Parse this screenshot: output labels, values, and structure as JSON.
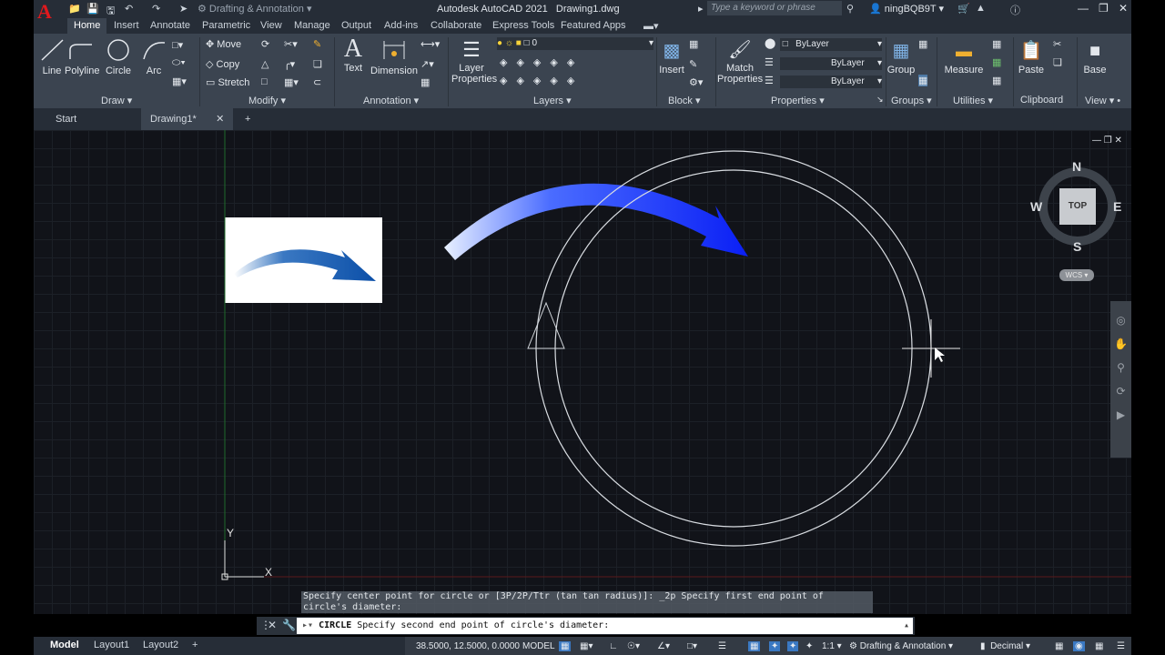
{
  "titlebar": {
    "workspace": "Drafting & Annotation",
    "app_title": "Autodesk AutoCAD 2021",
    "file_name": "Drawing1.dwg",
    "search_placeholder": "Type a keyword or phrase",
    "user": "ningBQB9T"
  },
  "ribbon_tabs": [
    "Home",
    "Insert",
    "Annotate",
    "Parametric",
    "View",
    "Manage",
    "Output",
    "Add-ins",
    "Collaborate",
    "Express Tools",
    "Featured Apps"
  ],
  "ribbon": {
    "draw": {
      "line": "Line",
      "polyline": "Polyline",
      "circle": "Circle",
      "arc": "Arc",
      "title": "Draw"
    },
    "modify": {
      "move": "Move",
      "copy": "Copy",
      "stretch": "Stretch",
      "title": "Modify"
    },
    "annotation": {
      "text": "Text",
      "dimension": "Dimension",
      "title": "Annotation"
    },
    "layers": {
      "layer_properties": "Layer Properties",
      "current_layer": "0",
      "title": "Layers"
    },
    "block": {
      "insert": "Insert",
      "title": "Block"
    },
    "properties": {
      "match": "Match Properties",
      "color": "ByLayer",
      "linetype": "ByLayer",
      "lineweight": "ByLayer",
      "title": "Properties"
    },
    "groups": {
      "group": "Group",
      "title": "Groups"
    },
    "utilities": {
      "measure": "Measure",
      "title": "Utilities"
    },
    "clipboard": {
      "paste": "Paste",
      "title": "Clipboard"
    },
    "view": {
      "base": "Base",
      "title": "View"
    }
  },
  "doc_tabs": {
    "start": "Start",
    "drawing": "Drawing1*"
  },
  "viewcube": {
    "n": "N",
    "s": "S",
    "e": "E",
    "w": "W",
    "face": "TOP",
    "wcs": "WCS"
  },
  "ucs": {
    "x": "X",
    "y": "Y"
  },
  "command": {
    "history": "Specify center point for circle or [3P/2P/Ttr (tan tan radius)]: _2p Specify first end point of circle's diameter:",
    "current_cmd": "CIRCLE",
    "prompt": "Specify second end point of circle's diameter:"
  },
  "status": {
    "layout_tabs": [
      "Model",
      "Layout1",
      "Layout2"
    ],
    "coords": "38.5000, 12.5000, 0.0000",
    "space": "MODEL",
    "scale": "1:1",
    "workspace": "Drafting & Annotation",
    "units": "Decimal"
  },
  "colors": {
    "accent_blue": "#0a2bff",
    "autocad_red": "#e0191d"
  }
}
